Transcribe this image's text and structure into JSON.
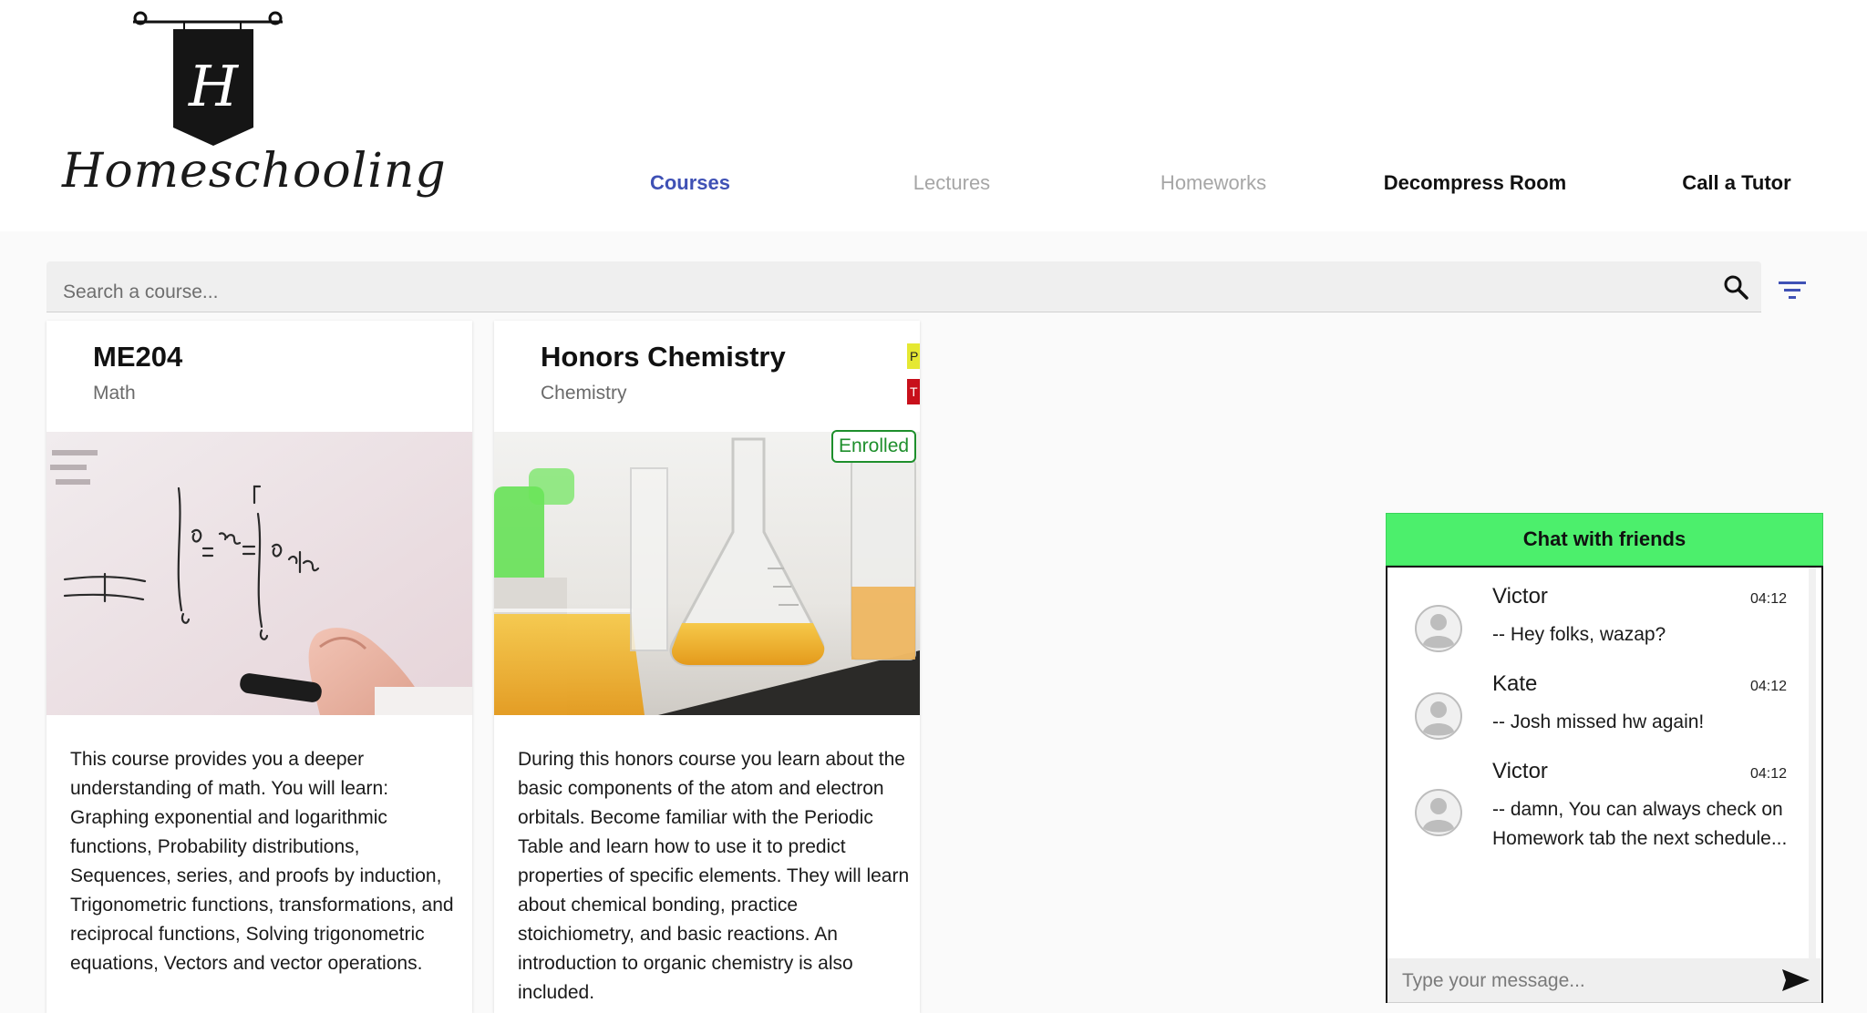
{
  "logo": {
    "letter": "H",
    "wordmark": "Homeschooling"
  },
  "nav": {
    "items": [
      {
        "label": "Courses",
        "state": "active"
      },
      {
        "label": "Lectures",
        "state": "muted"
      },
      {
        "label": "Homeworks",
        "state": "muted"
      },
      {
        "label": "Decompress Room",
        "state": "normal"
      },
      {
        "label": "Call a Tutor",
        "state": "normal"
      }
    ]
  },
  "search": {
    "placeholder": "Search a course...",
    "value": ""
  },
  "colors": {
    "accent": "#3f51b5",
    "chat_header": "#4cef6c",
    "enrolled": "#1e8f2c",
    "tag_yellow": "#e5e832",
    "tag_red": "#c8101b"
  },
  "courses": [
    {
      "code": "ME204",
      "subject": "Math",
      "enrolled": false,
      "description": "This course provides you a deeper understanding of math. You will learn: Graphing exponential and logarithmic functions, Probability distributions, Sequences, series, and proofs by induction, Trigonometric functions, transformations, and reciprocal functions, Solving trigonometric equations, Vectors and vector operations."
    },
    {
      "code": "Honors Chemistry",
      "subject": "Chemistry",
      "enrolled": true,
      "enrolled_label": "Enrolled",
      "tags": [
        "P",
        "T"
      ],
      "description": "During this honors course you learn about the basic components of the atom and electron orbitals. Become familiar with the Periodic Table and learn how to use it to predict properties of specific elements. They will learn about chemical bonding, practice stoichiometry, and basic reactions. An introduction to organic chemistry is also included."
    }
  ],
  "chat": {
    "title": "Chat with friends",
    "messages": [
      {
        "name": "Victor",
        "time": "04:12",
        "text": "-- Hey folks, wazap?"
      },
      {
        "name": "Kate",
        "time": "04:12",
        "text": "-- Josh missed hw again!"
      },
      {
        "name": "Victor",
        "time": "04:12",
        "text": "-- damn, You can always check on Homework tab the next schedule..."
      }
    ],
    "input_placeholder": "Type your message..."
  }
}
